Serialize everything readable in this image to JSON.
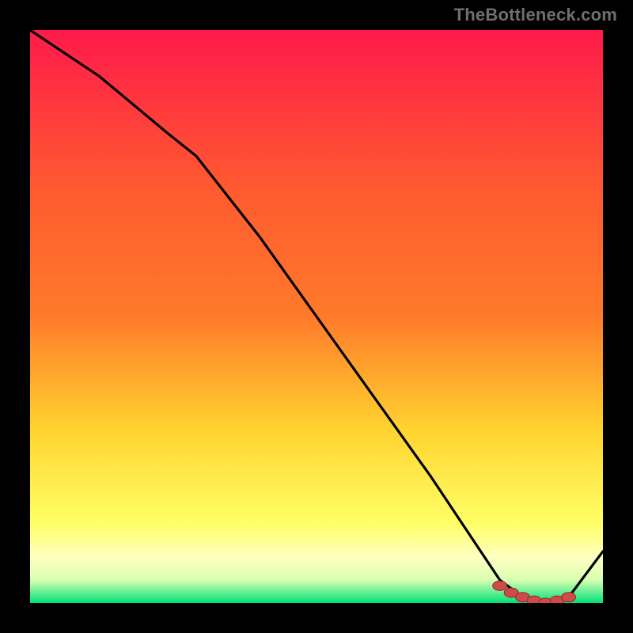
{
  "attribution": "TheBottleneck.com",
  "colors": {
    "top": "#ff1a4a",
    "upper_mid": "#ff7a2a",
    "mid": "#ffd430",
    "lower_mid": "#ffff66",
    "pale_yellow": "#ffffc0",
    "green": "#00e07a",
    "line": "#000000",
    "marker": "#d04a4a",
    "marker_stroke": "#8a2a2a"
  },
  "chart_data": {
    "type": "line",
    "title": "",
    "xlabel": "",
    "ylabel": "",
    "xlim": [
      0,
      100
    ],
    "ylim": [
      0,
      100
    ],
    "series": [
      {
        "name": "curve",
        "x": [
          0,
          12,
          24,
          29,
          40,
          50,
          60,
          70,
          78,
          82,
          86,
          90,
          94,
          100
        ],
        "values": [
          100,
          92,
          82,
          78,
          64,
          50,
          36,
          22,
          10,
          4,
          1,
          0,
          1,
          9
        ]
      }
    ],
    "markers": {
      "name": "highlight-segment",
      "x": [
        82,
        84,
        86,
        88,
        90,
        92,
        94
      ],
      "values": [
        3,
        1.8,
        1,
        0.4,
        0,
        0.4,
        1
      ]
    }
  }
}
